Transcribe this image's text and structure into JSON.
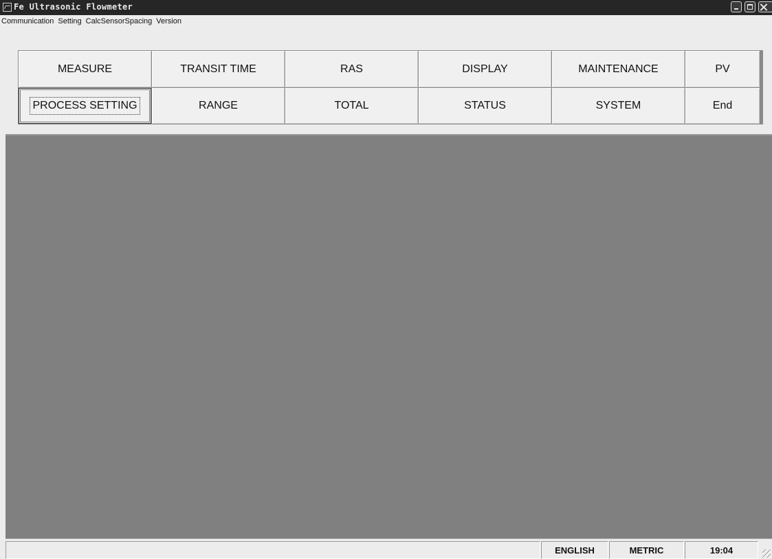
{
  "window": {
    "title": "Fe Ultrasonic Flowmeter",
    "icon": "chart-window-icon"
  },
  "menu": {
    "items": [
      "Communication",
      "Setting",
      "CalcSensorSpacing",
      "Version"
    ]
  },
  "buttons": {
    "row1": [
      "MEASURE",
      "TRANSIT TIME",
      "RAS",
      "DISPLAY",
      "MAINTENANCE",
      "PV"
    ],
    "row2": [
      "PROCESS SETTING",
      "RANGE",
      "TOTAL",
      "STATUS",
      "SYSTEM",
      "End"
    ],
    "focused": "PROCESS SETTING"
  },
  "status": {
    "main": "",
    "language": "ENGLISH",
    "units": "METRIC",
    "time": "19:04"
  },
  "colors": {
    "titlebar": "#262626",
    "client_area": "#808080",
    "chrome": "#ececec"
  }
}
